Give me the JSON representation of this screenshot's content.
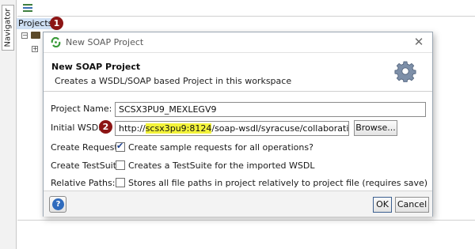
{
  "navigator": {
    "tab_label": "Navigator"
  },
  "tree": {
    "root_label": "Projects"
  },
  "callouts": {
    "one": "1",
    "two": "2"
  },
  "dialog": {
    "title": "New SOAP Project",
    "header_title": "New SOAP Project",
    "header_description": "Creates a WSDL/SOAP based Project in this workspace",
    "fields": {
      "project_name_label": "Project Name:",
      "project_name_value": "SCSX3PU9_MEXLEGV9",
      "wsdl_label": "Initial WSDL:",
      "wsdl_prefix": "http://",
      "wsdl_host": "scsx3pu9:8124",
      "wsdl_suffix": "/soap-wsdl/syracuse/collaboration/syracu",
      "browse_label": "Browse...",
      "create_requests_label": "Create Requests:",
      "create_requests_text": "Create sample requests for all operations?",
      "create_requests_checked": true,
      "create_testsuite_label": "Create TestSuite:",
      "create_testsuite_text": "Creates a TestSuite for the imported WSDL",
      "create_testsuite_checked": false,
      "relative_paths_label": "Relative Paths:",
      "relative_paths_text": "Stores all file paths in project relatively to project file (requires save)",
      "relative_paths_checked": false
    },
    "help_label": "?",
    "ok_label": "OK",
    "cancel_label": "Cancel"
  },
  "colors": {
    "callout": "#8c1515",
    "highlight": "#f3f33a",
    "selection": "#cfe0f4",
    "help_blue": "#2f6bbd"
  }
}
